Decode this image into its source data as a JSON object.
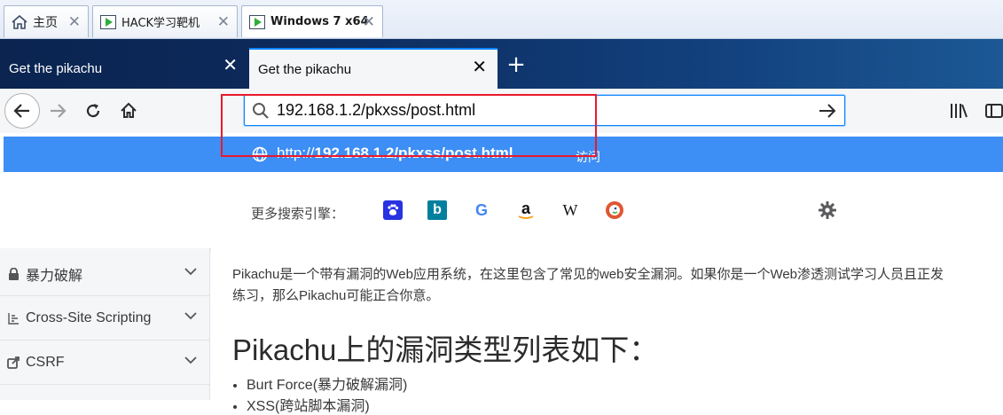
{
  "vm_tabs": [
    {
      "label": "主页",
      "icon": "home-icon"
    },
    {
      "label": "HACK学习靶机",
      "icon": "vm-icon"
    },
    {
      "label": "Windows 7 x64",
      "icon": "vm-icon",
      "active": true
    }
  ],
  "browser_tabs": [
    {
      "title": "Get the pikachu"
    },
    {
      "title": "Get the pikachu",
      "active": true
    }
  ],
  "new_tab_label": "+",
  "close_glyph": "✕",
  "url_bar": {
    "value": "192.168.1.2/pkxss/post.html"
  },
  "suggestion": {
    "prefix": "http://",
    "url_bold": "192.168.1.2/pkxss/post.html",
    "action": "访问"
  },
  "search_engines": {
    "label": "更多搜索引擎：",
    "engines": [
      "baidu",
      "bing",
      "google",
      "amazon",
      "wikipedia",
      "duckduckgo"
    ],
    "amazon_glyph": "a",
    "wiki_glyph": "W",
    "bing_glyph": "b",
    "google_glyph": "G"
  },
  "sidebar": {
    "items": [
      {
        "label": "暴力破解",
        "icon": "lock-icon"
      },
      {
        "label": "Cross-Site Scripting",
        "icon": "list-icon"
      },
      {
        "label": "CSRF",
        "icon": "share-icon"
      }
    ]
  },
  "main": {
    "intro_line1": "Pikachu是一个带有漏洞的Web应用系统，在这里包含了常见的web安全漏洞。如果你是一个Web渗透测试学习人员且正发",
    "intro_line2": "练习，那么Pikachu可能正合你意。",
    "heading": "Pikachu上的漏洞类型列表如下：",
    "list": [
      "Burt Force(暴力破解漏洞)",
      "XSS(跨站脚本漏洞)"
    ]
  },
  "colors": {
    "accent": "#0a84ff",
    "suggestion_bg": "#3d8ef5",
    "highlight": "#e8192c",
    "firefox_tabbar": "#0c2a5c"
  }
}
